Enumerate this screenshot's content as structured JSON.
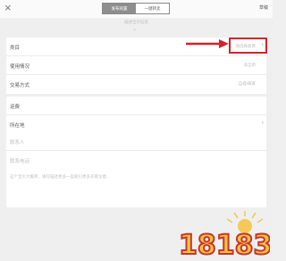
{
  "topbar": {
    "close_glyph": "×",
    "tab_active": "发布闲置",
    "tab_inactive": "一键转卖",
    "next_label": "草稿"
  },
  "hint": {
    "text": "描述宝贝信息"
  },
  "sections": {
    "category": {
      "label": "类目",
      "value": "请选择类目"
    },
    "condition": {
      "label": "使用情况",
      "value": "非全新"
    },
    "trade": {
      "label": "交易方式",
      "value": "自提/邮寄"
    },
    "shipping": {
      "label": "运费"
    },
    "location": {
      "label": "所在地"
    },
    "contact": {
      "placeholder": "联系人"
    },
    "phone": {
      "placeholder": "联系电话"
    }
  },
  "remark": {
    "placeholder": "这个宝贝大概率，填写描述更多一些吸引更多买家注意..."
  },
  "watermark": {
    "text": "18183",
    "color_red": "#c8352d",
    "color_yellow": "#f6c23c"
  },
  "colors": {
    "highlight": "#d2232a"
  }
}
